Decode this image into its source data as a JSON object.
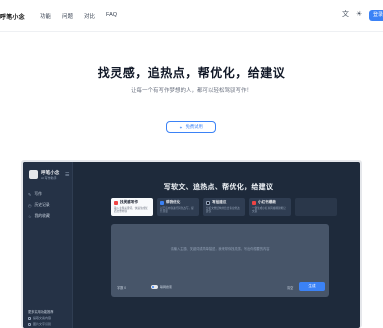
{
  "header": {
    "logo": "呼笔小念",
    "nav": [
      "功能",
      "问题",
      "对比",
      "FAQ"
    ],
    "lang_icon": "translate-icon",
    "theme_icon": "sun-icon",
    "cta": "登录"
  },
  "hero": {
    "title": "找灵感，追热点，帮优化，给建议",
    "subtitle": "让每一个有写作梦想的人，都可以轻松驾驭写作！",
    "button": "免费试用",
    "button_icon": "sparkle-icon"
  },
  "preview": {
    "sidebar": {
      "brand": "呼笔小念",
      "tagline": "AI 写作助手",
      "menu": [
        {
          "icon": "pen-icon",
          "label": "写作"
        },
        {
          "icon": "history-icon",
          "label": "历史记录"
        },
        {
          "icon": "star-icon",
          "label": "我的收藏"
        }
      ],
      "bottom_title": "更多实用功能推荐",
      "bottom_items": [
        "提取文案内容",
        "图片文字识别"
      ]
    },
    "title": "写软文、追热点、帮优化，给建议",
    "cards": [
      {
        "title": "找灵感写作",
        "desc": "输入主题关键词，快速生成优质文章内容",
        "color": "#ef4444",
        "active": true
      },
      {
        "title": "帮我优化",
        "desc": "对已有内容进行润色改写，提升质量",
        "color": "#3b82f6",
        "active": false
      },
      {
        "title": "写给建议",
        "desc": "分析文章结构并给出专业修改建议",
        "color": "#111827",
        "active": false
      },
      {
        "title": "小红书爆款",
        "desc": "一键生成小红书风格爆款笔记文案",
        "color": "#ef4444",
        "active": false
      }
    ],
    "editor": {
      "placeholder": "请输入主题、关键词或简单描述，我来帮你找灵感，写出你想要的内容",
      "word_count": "字数 0",
      "toggle_label": "联网搜索",
      "clear": "清空",
      "submit": "生成"
    }
  }
}
